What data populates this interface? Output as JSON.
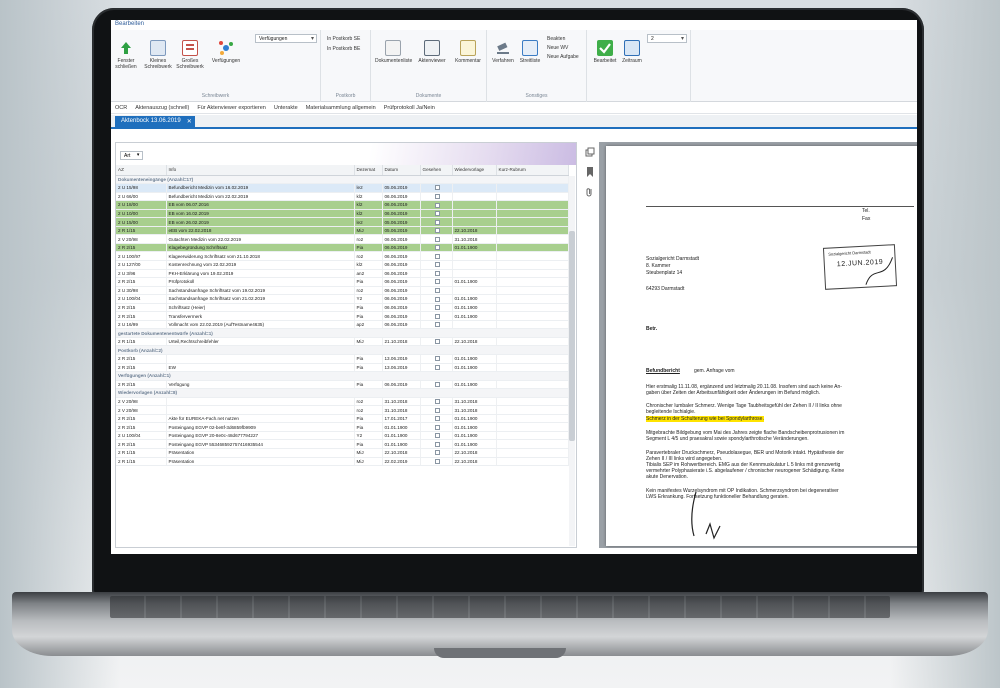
{
  "ribbon": {
    "tab": "Bearbeiten",
    "buttons": {
      "fenster": "Fenster schließen",
      "kleines": "Kleines Schreibwerk",
      "grosses": "Großes Schreibwerk",
      "verfuegungen": "Verfügungen",
      "verfuegungen_combo": "Verfügungen",
      "group_schreibwerk": "Schreibwerk",
      "postkorb_se": "In Postkorb SE",
      "postkorb_be": "In Postkorb BE",
      "group_postkorb": "Postkorb",
      "dokumentenliste": "Dokumentenliste",
      "aktenviewer": "Aktenviewer",
      "kommentar": "Kommentar",
      "group_dokumente": "Dokumente",
      "verfahren": "Verfahren",
      "streitliste": "Streitliste",
      "beakten": "Beakten",
      "neue_wv": "Neue WV",
      "neue_aufgabe": "Neue Aufgabe",
      "group_sonstiges": "Sonstiges",
      "bearbeitet": "Bearbeitet",
      "zeitraum": "Zeitraum",
      "zeitraum_value": "2"
    }
  },
  "quickbar": [
    "OCR",
    "Aktenauszug (schnell)",
    "Für Aktenviewer exportieren",
    "Unterakte",
    "Materialsammlung allgemein",
    "Prüfprotokoll Ja/Nein"
  ],
  "doc_tab": {
    "label": "Aktenbock 13.06.2019",
    "close": "✕"
  },
  "grid": {
    "group_by": "Art",
    "columns": [
      "AZ",
      "Info",
      "Dezernat",
      "Datum",
      "Gesehen",
      "Wiedervorlage",
      "Kurz-Rubrum"
    ],
    "rows": [
      {
        "type": "group",
        "label": "Dokumenteneingänge (Anzahl=17)"
      },
      {
        "type": "sel",
        "az": "2 U 15/98",
        "info": "Befundbericht Medizin vom 16.02.2019",
        "dez": "le2",
        "datum": "05.06.2019",
        "wv": ""
      },
      {
        "az": "2 U 66/00",
        "info": "Befundbericht Medizin vom 22.02.2019",
        "dez": "kl2",
        "datum": "06.06.2019",
        "wv": ""
      },
      {
        "type": "hl",
        "az": "2 U 18/00",
        "info": "EB vom 06.07.2016",
        "dez": "kl2",
        "datum": "06.06.2019",
        "wv": ""
      },
      {
        "type": "hl",
        "az": "2 U 10/00",
        "info": "EB vom 16.02.2019",
        "dez": "kl2",
        "datum": "06.06.2019",
        "wv": ""
      },
      {
        "type": "hl",
        "az": "2 U 15/00",
        "info": "EB vom 26.02.2019",
        "dez": "le2",
        "datum": "05.06.2019",
        "wv": ""
      },
      {
        "type": "hl",
        "az": "2 R 1/15",
        "info": "eEB vom 22.02.2018",
        "dez": "MiJ",
        "datum": "05.06.2019",
        "wv": "22.10.2018"
      },
      {
        "az": "2 V 20/98",
        "info": "Gutachten Medizin vom 22.02.2019",
        "dez": "ro2",
        "datum": "06.06.2019",
        "wv": "31.10.2018"
      },
      {
        "type": "hl",
        "az": "2 R 2/15",
        "info": "Klagebegründung Schriftsatz",
        "dez": "Pia",
        "datum": "06.06.2019",
        "wv": "01.01.1900"
      },
      {
        "az": "2 U 100/97",
        "info": "Klageerwiderung Schriftsatz vom 21.10.2018",
        "dez": "ro2",
        "datum": "06.06.2019",
        "wv": ""
      },
      {
        "az": "2 U 127/00",
        "info": "Kostenrechnung vom 22.02.2019",
        "dez": "kl2",
        "datum": "06.06.2019",
        "wv": ""
      },
      {
        "az": "2 U 3/96",
        "info": "PKH-Erklärung vom 19.02.2019",
        "dez": "an2",
        "datum": "06.06.2019",
        "wv": ""
      },
      {
        "az": "2 R 2/15",
        "info": "Prüfprotokoll",
        "dez": "Pia",
        "datum": "06.06.2019",
        "wv": "01.01.1900"
      },
      {
        "az": "2 U 30/98",
        "info": "Sachstandsanfrage Schriftsatz vom 19.02.2019",
        "dez": "ro2",
        "datum": "06.06.2019",
        "wv": ""
      },
      {
        "az": "2 U 100/04",
        "info": "Sachstandsanfrage Schriftsatz vom 21.02.2019",
        "dez": "Y2",
        "datum": "06.06.2019",
        "wv": "01.01.1900"
      },
      {
        "az": "2 R 2/15",
        "info": "Schriftsatz (Heier)",
        "dez": "Pia",
        "datum": "06.06.2019",
        "wv": "01.01.1900"
      },
      {
        "az": "2 R 2/15",
        "info": "Transfervermerk",
        "dez": "Pia",
        "datum": "06.06.2019",
        "wv": "01.01.1900"
      },
      {
        "az": "2 U 16/99",
        "info": "Vollmacht vom 22.02.2019 (AufTestname4635)",
        "dez": "ap2",
        "datum": "06.06.2019",
        "wv": ""
      },
      {
        "type": "group",
        "label": "gestartete Dokumentenentwürfe (Anzahl=1)"
      },
      {
        "az": "2 R 1/15",
        "info": "Urteil,Rechtschreibfehler",
        "dez": "MiJ",
        "datum": "21.10.2018",
        "wv": "22.10.2018"
      },
      {
        "type": "group",
        "label": "Postkorb (Anzahl=2)"
      },
      {
        "az": "2 R 2/15",
        "info": "",
        "dez": "Pia",
        "datum": "13.06.2019",
        "wv": "01.01.1900"
      },
      {
        "az": "2 R 2/15",
        "info": "EW",
        "dez": "Pia",
        "datum": "13.06.2019",
        "wv": "01.01.1900"
      },
      {
        "type": "group",
        "label": "Verfügungen (Anzahl=1)"
      },
      {
        "az": "2 R 2/15",
        "info": "Verfügung",
        "dez": "Pia",
        "datum": "06.06.2019",
        "wv": "01.01.1900"
      },
      {
        "type": "group",
        "label": "Wiedervorlagen (Anzahl=8)"
      },
      {
        "az": "2 V 20/98",
        "info": "",
        "dez": "ro2",
        "datum": "31.10.2018",
        "wv": "31.10.2018"
      },
      {
        "az": "2 V 20/98",
        "info": "",
        "dez": "ro2",
        "datum": "31.10.2018",
        "wv": "31.10.2018"
      },
      {
        "az": "2 R 2/15",
        "info": "Akte für EUREKA-Fach.net nutzen",
        "dez": "Pia",
        "datum": "17.01.2017",
        "wv": "01.01.1900"
      },
      {
        "az": "2 R 2/15",
        "info": "Posteingang EGVP 02-be8f-3d6859fb9909",
        "dez": "Pia",
        "datum": "01.01.1900",
        "wv": "01.01.1900"
      },
      {
        "az": "2 U 100/04",
        "info": "Posteingang EGVP 20-8e0c-48d677794227",
        "dez": "Y2",
        "datum": "01.01.1900",
        "wv": "01.01.1900"
      },
      {
        "az": "2 R 2/15",
        "info": "Posteingang EGVP 553468592757416935544",
        "dez": "Pia",
        "datum": "01.01.1900",
        "wv": "01.01.1900"
      },
      {
        "az": "2 R 1/15",
        "info": "Präsentation",
        "dez": "MiJ",
        "datum": "22.10.2018",
        "wv": "22.10.2018"
      },
      {
        "az": "2 R 1/15",
        "info": "Präsentation",
        "dez": "MiJ",
        "datum": "22.02.2019",
        "wv": "22.10.2018"
      }
    ]
  },
  "document": {
    "tel": "Tel.",
    "fax": "Fax",
    "address": [
      "Sozialgericht Darmstadt",
      "8. Kammer",
      "Steubenplatz 14",
      "",
      "64293 Darmstadt"
    ],
    "stamp_title": "Sozialgericht Darmstadt",
    "stamp_date": "12.JUN.2019",
    "betr": "Betr.",
    "heading": "Befundbericht",
    "heading_suffix": "gem. Anfrage vom",
    "para1": [
      "Hier erstmalig 11.11.08, ergänzend und letztmalig 20.11.08. Insofern sind auch keine An-",
      "gaben über Zeiten der Arbeitsunfähigkeit oder Änderungen im Befund möglich."
    ],
    "para2": [
      "Chronischer lumbaler Schmerz. Wenige Tage Taubheitsgefühl der Zehen II / II links ohne",
      "begleitende Ischialgie."
    ],
    "highlight": "Schmerz in der Schulterung wie bei Spondylarthrose.",
    "para3": [
      "Mitgebrachte Bildgebung vom Mai des Jahres zeigte flache Bandscheibenprotrusionen im",
      "Segment L 4/5 und praesakral sowie spondylarthrotische Veränderungen."
    ],
    "para4": [
      "Paravertebraler Druckschmerz, Pseudolasegue, BER und Motorik intakt. Hypästhesie der",
      "Zehen II / III links wird angegeben.",
      "Tibialis SEP im Rohwertbereich. EMG aus der Kennmuskulatur L 5 links mit grenzwertig",
      "vermehrter Polyphasierate i.S. abgelaufener / chronischer neurogener Schädigung. Keine",
      "akute Denervation."
    ],
    "para5": [
      "Kein manifestes Wurzelsyndrom mit OP Indikation. Schmerzsyndrom bei degenerativer",
      "LWS Erkrankung. Fortsetzung funktioneller Behandlung geraten."
    ]
  }
}
